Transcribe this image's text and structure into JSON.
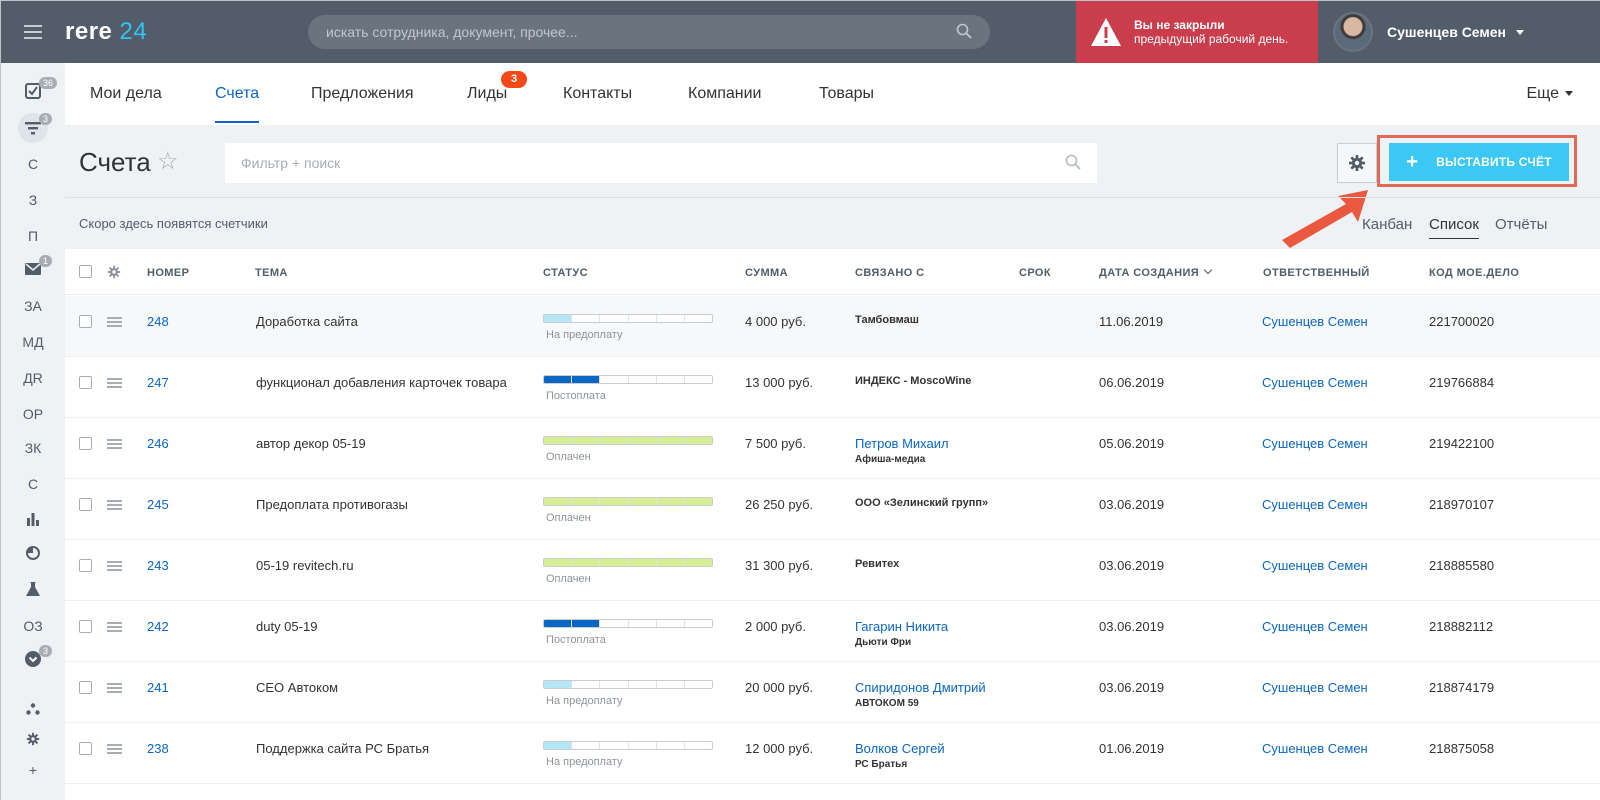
{
  "app": {
    "logo_text": "rere",
    "logo_num": "24"
  },
  "search": {
    "placeholder": "искать сотрудника, документ, прочее..."
  },
  "alert": {
    "line1": "Вы не закрыли",
    "line2": "предыдущий рабочий день."
  },
  "user": {
    "name": "Сушенцев Семен"
  },
  "sidebar": {
    "items": [
      {
        "label": "",
        "icon": "tasks-icon",
        "badge": "36"
      },
      {
        "label": "",
        "icon": "filter-icon",
        "badge": "3"
      },
      {
        "label": "С",
        "badge": ""
      },
      {
        "label": "З",
        "badge": ""
      },
      {
        "label": "П",
        "badge": ""
      },
      {
        "label": "",
        "icon": "mail-icon",
        "badge": "1"
      },
      {
        "label": "ЗА",
        "badge": ""
      },
      {
        "label": "МД",
        "badge": ""
      },
      {
        "label": "ДR",
        "badge": ""
      },
      {
        "label": "ОР",
        "badge": ""
      },
      {
        "label": "ЗК",
        "badge": ""
      },
      {
        "label": "С",
        "badge": ""
      },
      {
        "label": "",
        "icon": "chart-icon",
        "badge": ""
      },
      {
        "label": "",
        "icon": "clock-icon",
        "badge": ""
      },
      {
        "label": "",
        "icon": "flask-icon",
        "badge": ""
      },
      {
        "label": "ОЗ",
        "badge": ""
      },
      {
        "label": "",
        "icon": "chevron-down-icon",
        "badge": "3"
      },
      {
        "label": "",
        "icon": "structure-icon",
        "badge": ""
      },
      {
        "label": "",
        "icon": "settings-icon",
        "badge": ""
      },
      {
        "label": "+",
        "badge": ""
      }
    ]
  },
  "tabs": [
    {
      "label": "Мои дела",
      "active": false,
      "badge": ""
    },
    {
      "label": "Счета",
      "active": true,
      "badge": ""
    },
    {
      "label": "Предложения",
      "active": false,
      "badge": ""
    },
    {
      "label": "Лиды",
      "active": false,
      "badge": "3"
    },
    {
      "label": "Контакты",
      "active": false,
      "badge": ""
    },
    {
      "label": "Компании",
      "active": false,
      "badge": ""
    },
    {
      "label": "Товары",
      "active": false,
      "badge": ""
    }
  ],
  "more_label": "Еще",
  "page": {
    "title": "Счета",
    "filter_placeholder": "Фильтр + поиск",
    "create_button": "ВЫСТАВИТЬ СЧЁТ",
    "counters_text": "Скоро здесь появятся счетчики"
  },
  "views": [
    "Канбан",
    "Список",
    "Отчёты"
  ],
  "columns": [
    "НОМЕР",
    "ТЕМА",
    "СТАТУС",
    "СУММА",
    "СВЯЗАНО С",
    "СРОК",
    "ДАТА СОЗДАНИЯ",
    "ОТВЕТСТВЕННЫЙ",
    "КОД МОЕ.ДЕЛО"
  ],
  "colors": {
    "accent": "#0b66c3",
    "button": "#3bc8f5",
    "alert": "#c93d4d",
    "badge": "#f54819"
  },
  "rows": [
    {
      "num": "248",
      "topic": "Доработка сайта",
      "status": "На предоплату",
      "status_kind": "prepay",
      "sum": "4 000 руб.",
      "link_main": "Тамбовмаш",
      "link_main_is_person": false,
      "link_sub": "",
      "date": "11.06.2019",
      "owner": "Сушенцев Семен",
      "code": "221700020"
    },
    {
      "num": "247",
      "topic": "функционал добавления карточек товара",
      "status": "Постоплата",
      "status_kind": "postpay",
      "sum": "13 000 руб.",
      "link_main": "ИНДЕКС - MoscoWine",
      "link_main_is_person": false,
      "link_sub": "",
      "date": "06.06.2019",
      "owner": "Сушенцев Семен",
      "code": "219766884"
    },
    {
      "num": "246",
      "topic": "автор декор 05-19",
      "status": "Оплачен",
      "status_kind": "paid",
      "sum": "7 500 руб.",
      "link_main": "Петров Михаил",
      "link_main_is_person": true,
      "link_sub": "Афиша-медиа",
      "date": "05.06.2019",
      "owner": "Сушенцев Семен",
      "code": "219422100"
    },
    {
      "num": "245",
      "topic": "Предоплата противогазы",
      "status": "Оплачен",
      "status_kind": "paid",
      "sum": "26 250 руб.",
      "link_main": "ООО «Зелинский групп»",
      "link_main_is_person": false,
      "link_sub": "",
      "date": "03.06.2019",
      "owner": "Сушенцев Семен",
      "code": "218970107"
    },
    {
      "num": "243",
      "topic": "05-19 revitech.ru",
      "status": "Оплачен",
      "status_kind": "paid",
      "sum": "31 300 руб.",
      "link_main": "Ревитех",
      "link_main_is_person": false,
      "link_sub": "",
      "date": "03.06.2019",
      "owner": "Сушенцев Семен",
      "code": "218885580"
    },
    {
      "num": "242",
      "topic": "duty 05-19",
      "status": "Постоплата",
      "status_kind": "postpay",
      "sum": "2 000 руб.",
      "link_main": "Гагарин Никита",
      "link_main_is_person": true,
      "link_sub": "Дьюти Фри",
      "date": "03.06.2019",
      "owner": "Сушенцев Семен",
      "code": "218882112"
    },
    {
      "num": "241",
      "topic": "CEO Автоком",
      "status": "На предоплату",
      "status_kind": "prepay",
      "sum": "20 000 руб.",
      "link_main": "Спиридонов Дмитрий",
      "link_main_is_person": true,
      "link_sub": "АВТОКОМ 59",
      "date": "03.06.2019",
      "owner": "Сушенцев Семен",
      "code": "218874179"
    },
    {
      "num": "238",
      "topic": "Поддержка сайта РС Братья",
      "status": "На предоплату",
      "status_kind": "prepay",
      "sum": "12 000 руб.",
      "link_main": "Волков Сергей",
      "link_main_is_person": true,
      "link_sub": "РС Братья",
      "date": "01.06.2019",
      "owner": "Сушенцев Семен",
      "code": "218875058"
    }
  ]
}
